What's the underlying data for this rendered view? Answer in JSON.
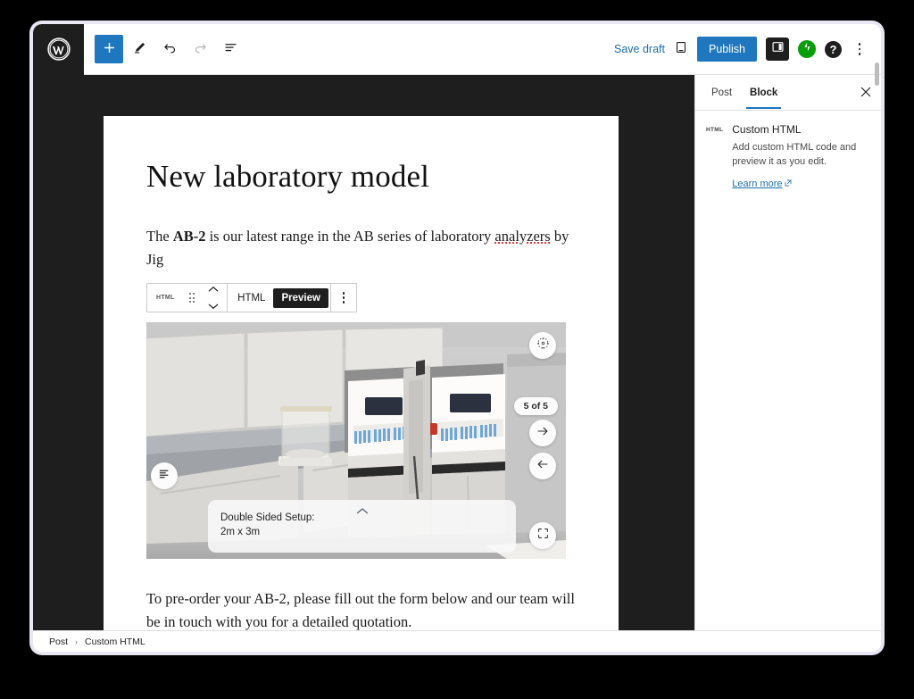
{
  "app": {
    "name": "WordPress Block Editor",
    "logo_icon": "wordpress-logo-icon"
  },
  "toolbar": {
    "add_block_label": "+",
    "add_block_icon": "plus-icon",
    "tools_icon": "pencil-icon",
    "undo_icon": "undo-icon",
    "redo_icon": "redo-icon",
    "outline_icon": "document-outline-icon",
    "save_draft_label": "Save draft",
    "preview_icon": "device-preview-icon",
    "publish_label": "Publish",
    "sidebar_toggle_icon": "settings-panel-icon",
    "jetpack_icon": "jetpack-icon",
    "help_icon": "help-question-icon",
    "options_icon": "more-options-kebab-icon",
    "accent_color": "#1e77bf",
    "link_color": "#1f6fa8",
    "jetpack_color": "#069e08"
  },
  "post": {
    "title": "New laboratory model",
    "paragraph_1": {
      "before": "The ",
      "bold": "AB-2",
      "middle": " is our latest range in the AB series of laboratory ",
      "misspelled": "analyzers",
      "after": " by Jig"
    },
    "paragraph_2": "To pre-order your AB-2, please fill out the form below and our team will be in touch with you for a detailed quotation."
  },
  "block_toolbar": {
    "block_type_icon": "html-block-icon",
    "block_type_label": "HTML",
    "drag_handle_icon": "drag-handle-icon",
    "move_up_icon": "chevron-up-icon",
    "move_down_icon": "chevron-down-icon",
    "mode_html_label": "HTML",
    "mode_preview_label": "Preview",
    "active_mode": "Preview",
    "options_icon": "block-options-kebab-icon"
  },
  "viewer": {
    "annotations_icon": "annotations-list-icon",
    "orbit_icon": "orbit-rotate-icon",
    "counter_label": "5 of 5",
    "next_icon": "arrow-right-icon",
    "prev_icon": "arrow-left-icon",
    "fullscreen_icon": "fullscreen-expand-icon",
    "expand_chevron_icon": "chevron-up-icon",
    "info_title": "Double Sided Setup:",
    "info_dimensions": "2m x 3m"
  },
  "sidebar": {
    "tab_post_label": "Post",
    "tab_block_label": "Block",
    "active_tab": "Block",
    "close_icon": "close-x-icon",
    "block_icon": "html-block-icon",
    "block_icon_label": "HTML",
    "block_title": "Custom HTML",
    "block_description": "Add custom HTML code and preview it as you edit.",
    "learn_more_label": "Learn more",
    "learn_more_icon": "external-link-icon"
  },
  "breadcrumb": {
    "items": [
      "Post",
      "Custom HTML"
    ],
    "separator": "›"
  }
}
